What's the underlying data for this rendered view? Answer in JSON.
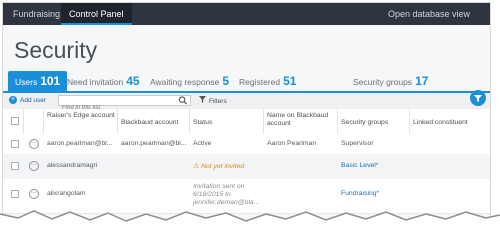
{
  "topbar": {
    "fundraising": "Fundraising",
    "control_panel": "Control Panel",
    "open_db": "Open database view"
  },
  "page": {
    "title": "Security"
  },
  "tabs": [
    {
      "label": "Users",
      "count": "101"
    },
    {
      "label": "Need invitation",
      "count": "45"
    },
    {
      "label": "Awaiting response",
      "count": "5"
    },
    {
      "label": "Registered",
      "count": "51"
    },
    {
      "label": "Security groups",
      "count": "17"
    }
  ],
  "toolbar": {
    "add_user": "Add user",
    "search_placeholder": "Find in this list",
    "filters": "Filters"
  },
  "table": {
    "headers": [
      "Raiser's Edge account",
      "Blackbaud account",
      "Status",
      "Name on Blackbaud account",
      "Security groups",
      "Linked constituent"
    ],
    "rows": [
      {
        "re_account": "aaron.pearlman@bl...",
        "bb_account": "aaron.pearlman@bl...",
        "status": "Active",
        "name": "Aaron Pearlman",
        "group": "Supervisor",
        "linked": ""
      },
      {
        "re_account": "alessandramagri",
        "bb_account": "",
        "status": "Not yet invited",
        "name": "",
        "group": "Basic Level*",
        "linked": ""
      },
      {
        "re_account": "alixrangolam",
        "bb_account": "",
        "status": "Invitation sent on 6/18/2015 to jennifer.deman@bla...",
        "name": "",
        "group": "Fundraising*",
        "linked": ""
      }
    ]
  },
  "colors": {
    "topbar": "#2f3540",
    "accent": "#1b8ed8",
    "warning": "#d9891f"
  },
  "icons": [
    "chevron-down-icon",
    "plus-icon",
    "search-icon",
    "filter-icon",
    "ellipsis-icon",
    "warning-icon"
  ]
}
